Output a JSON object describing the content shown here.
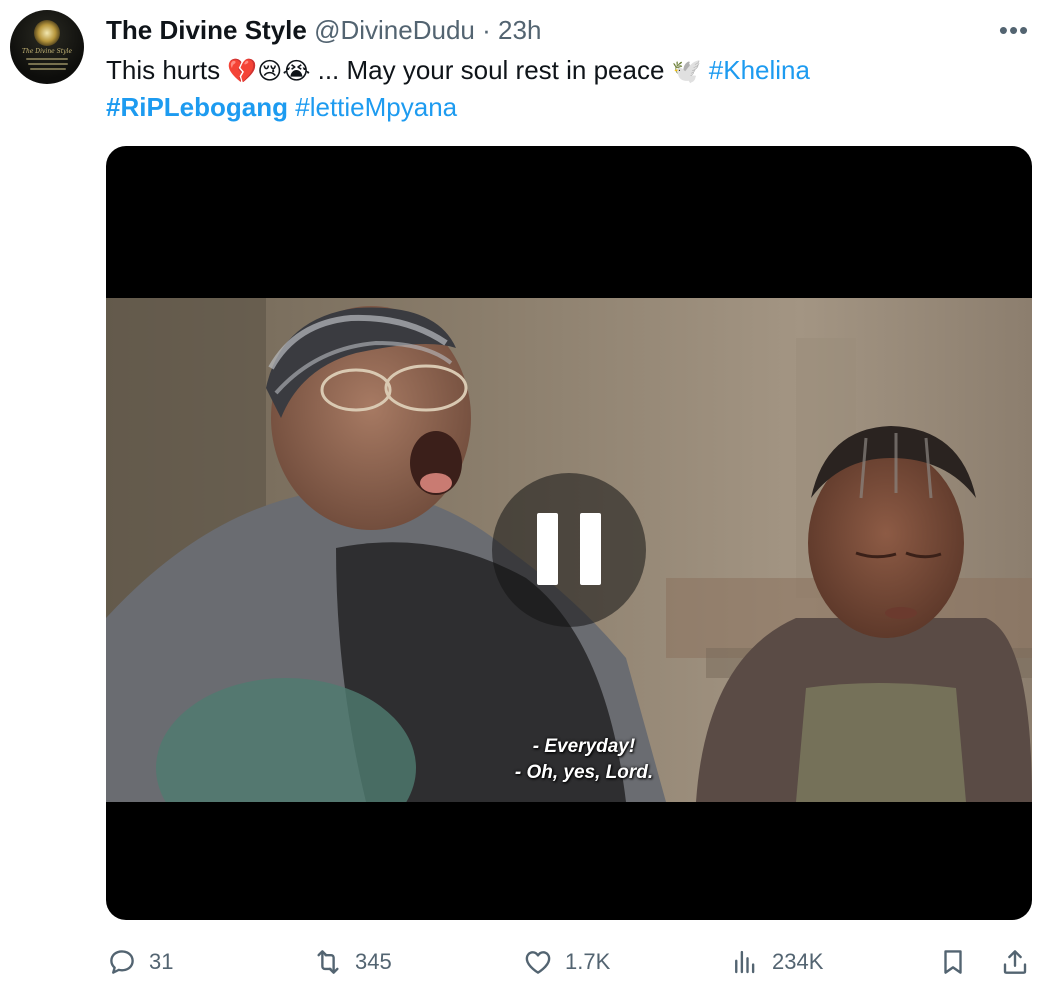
{
  "author": {
    "name": "The Divine Style",
    "handle": "@DivineDudu",
    "separator": "·",
    "time": "23h",
    "avatar_text": "The Divine Style"
  },
  "more_label": "•••",
  "tweet": {
    "text_start": "This hurts",
    "emojis_1": [
      "💔",
      "😢",
      "😭"
    ],
    "text_middle": "... May your soul rest in peace",
    "emoji_dove": "🕊️",
    "hashtags": [
      "#Khelina",
      "#RiPLebogang",
      "#lettieMpyana"
    ]
  },
  "video": {
    "subtitle_line_1": "- Everyday!",
    "subtitle_line_2": "- Oh, yes, Lord.",
    "state": "playing"
  },
  "actions": {
    "replies": "31",
    "reposts": "345",
    "likes": "1.7K",
    "views": "234K"
  },
  "colors": {
    "accent": "#1d9bf0",
    "secondary_text": "#536471",
    "primary_text": "#0f1419"
  }
}
